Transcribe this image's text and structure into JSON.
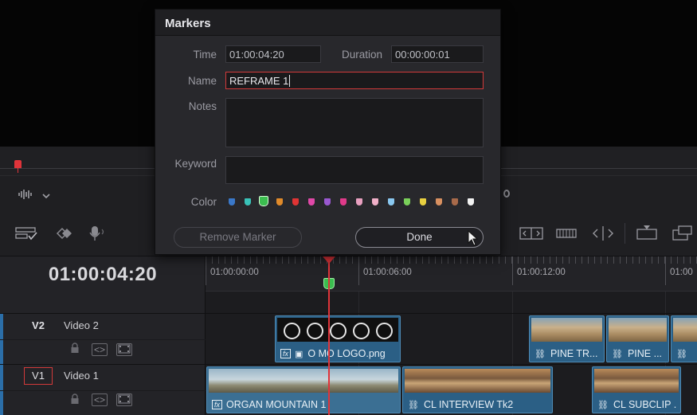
{
  "modal": {
    "title": "Markers",
    "time_label": "Time",
    "time_value": "01:00:04:20",
    "duration_label": "Duration",
    "duration_value": "00:00:00:01",
    "name_label": "Name",
    "name_value": "REFRAME 1",
    "notes_label": "Notes",
    "notes_value": "",
    "keyword_label": "Keyword",
    "keyword_value": "",
    "color_label": "Color",
    "colors": [
      "#3a78c9",
      "#39c2b8",
      "#3bbd4f",
      "#e08a2a",
      "#e03434",
      "#e048a8",
      "#9a58d0",
      "#e03a8a",
      "#e8a0c0",
      "#f0b0c8",
      "#8ac8f0",
      "#7ad05a",
      "#e8d040",
      "#d89060",
      "#a86a4a",
      "#f2f2f2"
    ],
    "selected_color_index": 2,
    "remove_button": "Remove Marker",
    "done_button": "Done"
  },
  "timeline": {
    "current_timecode": "01:00:04:20",
    "ruler_labels": [
      "01:00:00:00",
      "01:00:06:00",
      "01:00:12:00",
      "01:00"
    ],
    "tracks": [
      {
        "id": "V2",
        "name": "Video 2"
      },
      {
        "id": "V1",
        "name": "Video 1"
      }
    ],
    "clips_v2": [
      {
        "label": "O MO LOGO.png",
        "fx": "fx",
        "kind": "logo"
      },
      {
        "label": "PINE TR...",
        "kind": "desert"
      },
      {
        "label": "PINE ...",
        "kind": "desert"
      },
      {
        "label": "",
        "kind": "desert"
      }
    ],
    "clips_v1": [
      {
        "label": "ORGAN MOUNTAIN 1",
        "fx": "fx",
        "kind": "sky"
      },
      {
        "label": "CL INTERVIEW Tk2",
        "kind": "people"
      },
      {
        "label": "CL SUBCLIP ...",
        "kind": "people"
      }
    ]
  },
  "icons": {
    "waveform": "waveform-icon",
    "chevron": "chevron-down-icon",
    "lock": "lock-icon",
    "auto_select": "auto-select-icon",
    "film": "film-icon",
    "link": "link-icon",
    "image": "image-icon"
  },
  "accent": {
    "playhead": "#e0343a",
    "clip": "#2b5f85",
    "marker_selected": "#3bbd4f"
  }
}
